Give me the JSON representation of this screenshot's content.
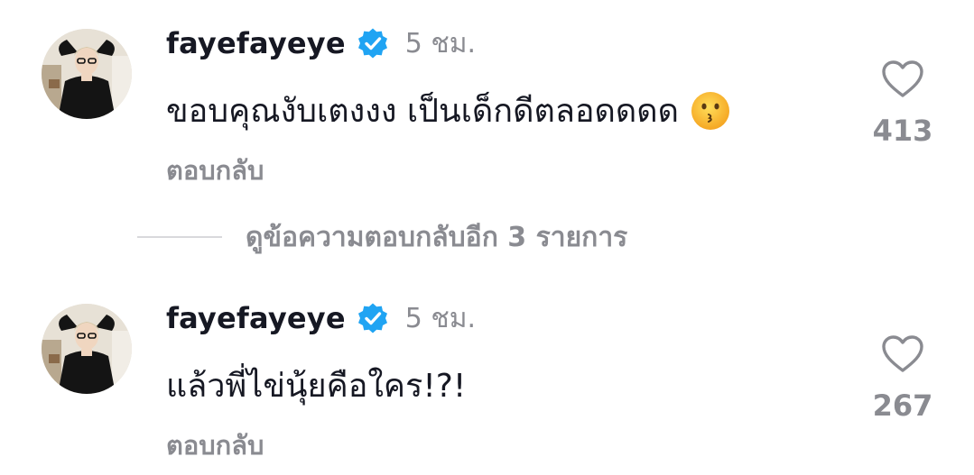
{
  "comments": [
    {
      "username": "fayefayeye",
      "verified_icon": "verified-badge-icon",
      "time": "5 ชม.",
      "text": "ขอบคุณงับเตงงง เป็นเด็กดีตลอดดดด",
      "emoji": "kissing-face-emoji",
      "reply_label": "ตอบกลับ",
      "like_count": "413",
      "like_icon": "heart-outline-icon"
    },
    {
      "username": "fayefayeye",
      "verified_icon": "verified-badge-icon",
      "time": "5 ชม.",
      "text": "แล้วพี่ไข่นุ้ยคือใคร!?!",
      "reply_label": "ตอบกลับ",
      "like_count": "267",
      "like_icon": "heart-outline-icon"
    }
  ],
  "view_replies": {
    "label": "ดูข้อความตอบกลับอีก 3 รายการ"
  },
  "colors": {
    "primary_text": "#161823",
    "secondary_text": "#8a8b91",
    "verified_blue": "#20a4f3",
    "divider": "#d9d9dc"
  }
}
